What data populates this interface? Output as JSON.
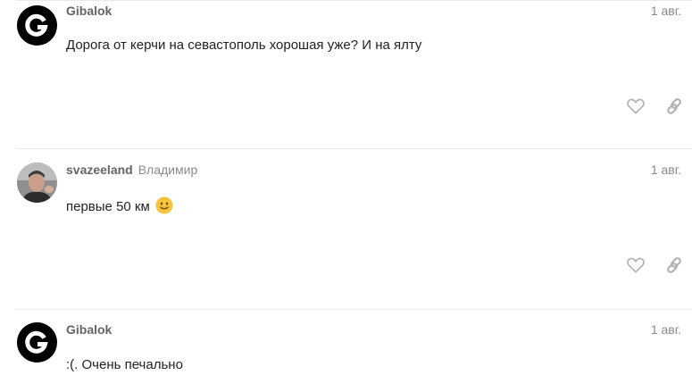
{
  "posts": [
    {
      "username": "Gibalok",
      "fullname": "",
      "date": "1 авг.",
      "text": "Дорога от керчи на севастополь хорошая уже? И на ялту",
      "avatar": "letter-avatar",
      "avatar_letter": "G",
      "actions": [
        "heart-icon",
        "link-icon"
      ]
    },
    {
      "username": "svazeeland",
      "fullname": "Владимир",
      "date": "1 авг.",
      "text": "первые 50 км",
      "emoji": "slightly-smiling-face",
      "avatar": "photo-avatar",
      "actions": [
        "heart-icon",
        "link-icon"
      ]
    },
    {
      "username": "Gibalok",
      "fullname": "",
      "date": "1 авг.",
      "text": ":(. Очень печально",
      "avatar": "letter-avatar",
      "avatar_letter": "G"
    }
  ],
  "colors": {
    "username": "#646464",
    "meta": "#8a8a8a",
    "text": "#222222",
    "divider": "#e9e9e9",
    "icon": "#b2b2b2",
    "emoji": "#f5c33b"
  }
}
